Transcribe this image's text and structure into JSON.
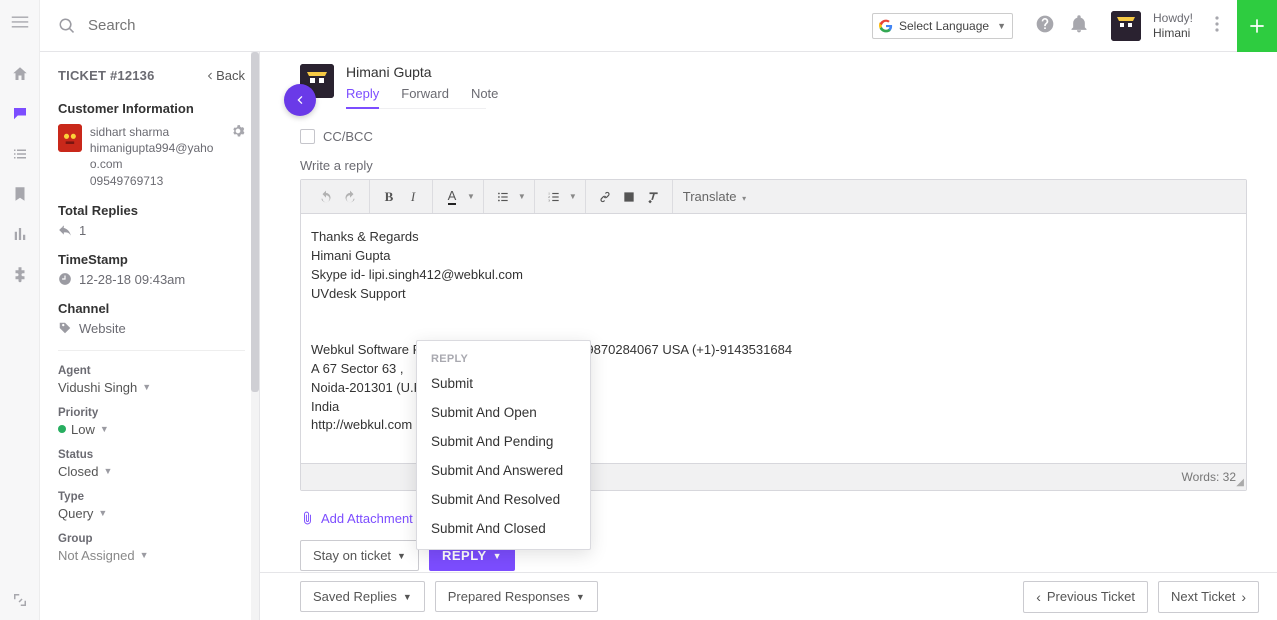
{
  "topbar": {
    "search_placeholder": "Search",
    "language_selector": "Select Language",
    "greeting": "Howdy!",
    "user_name": "Himani"
  },
  "sidebar": {
    "ticket_label": "TICKET #12136",
    "back": "Back",
    "customer_heading": "Customer Information",
    "customer": {
      "name": "sidhart sharma",
      "email": "himanigupta994@yahoo.com",
      "phone": "09549769713"
    },
    "replies_label": "Total Replies",
    "replies_count": "1",
    "timestamp_label": "TimeStamp",
    "timestamp_value": "12-28-18 09:43am",
    "channel_label": "Channel",
    "channel_value": "Website",
    "fields": {
      "agent_label": "Agent",
      "agent_value": "Vidushi Singh",
      "priority_label": "Priority",
      "priority_value": "Low",
      "status_label": "Status",
      "status_value": "Closed",
      "type_label": "Type",
      "type_value": "Query",
      "group_label": "Group",
      "group_value": "Not Assigned"
    }
  },
  "thread": {
    "author": "Himani Gupta",
    "tabs": {
      "reply": "Reply",
      "forward": "Forward",
      "note": "Note"
    },
    "ccbcc": "CC/BCC",
    "write_label": "Write a reply",
    "toolbar_translate": "Translate",
    "body_lines": [
      "Thanks & Regards",
      "Himani Gupta",
      "Skype id- lipi.singh412@webkul.com",
      "UVdesk Support",
      "",
      "",
      "Webkul Software Pvt. Ltd. Contact : India (+91)-9870284067 USA (+1)-9143531684",
      "A 67 Sector 63 ,",
      "Noida-201301 (U.P.)",
      "India",
      "http://webkul.com"
    ],
    "word_count": "Words: 32",
    "attach": "Add Attachment",
    "stay": "Stay on ticket",
    "reply_btn": "REPLY"
  },
  "reply_menu": {
    "heading": "REPLY",
    "items": [
      "Submit",
      "Submit And Open",
      "Submit And Pending",
      "Submit And Answered",
      "Submit And Resolved",
      "Submit And Closed"
    ]
  },
  "bottom": {
    "saved": "Saved Replies",
    "prepared": "Prepared Responses",
    "prev": "Previous Ticket",
    "next": "Next Ticket"
  }
}
